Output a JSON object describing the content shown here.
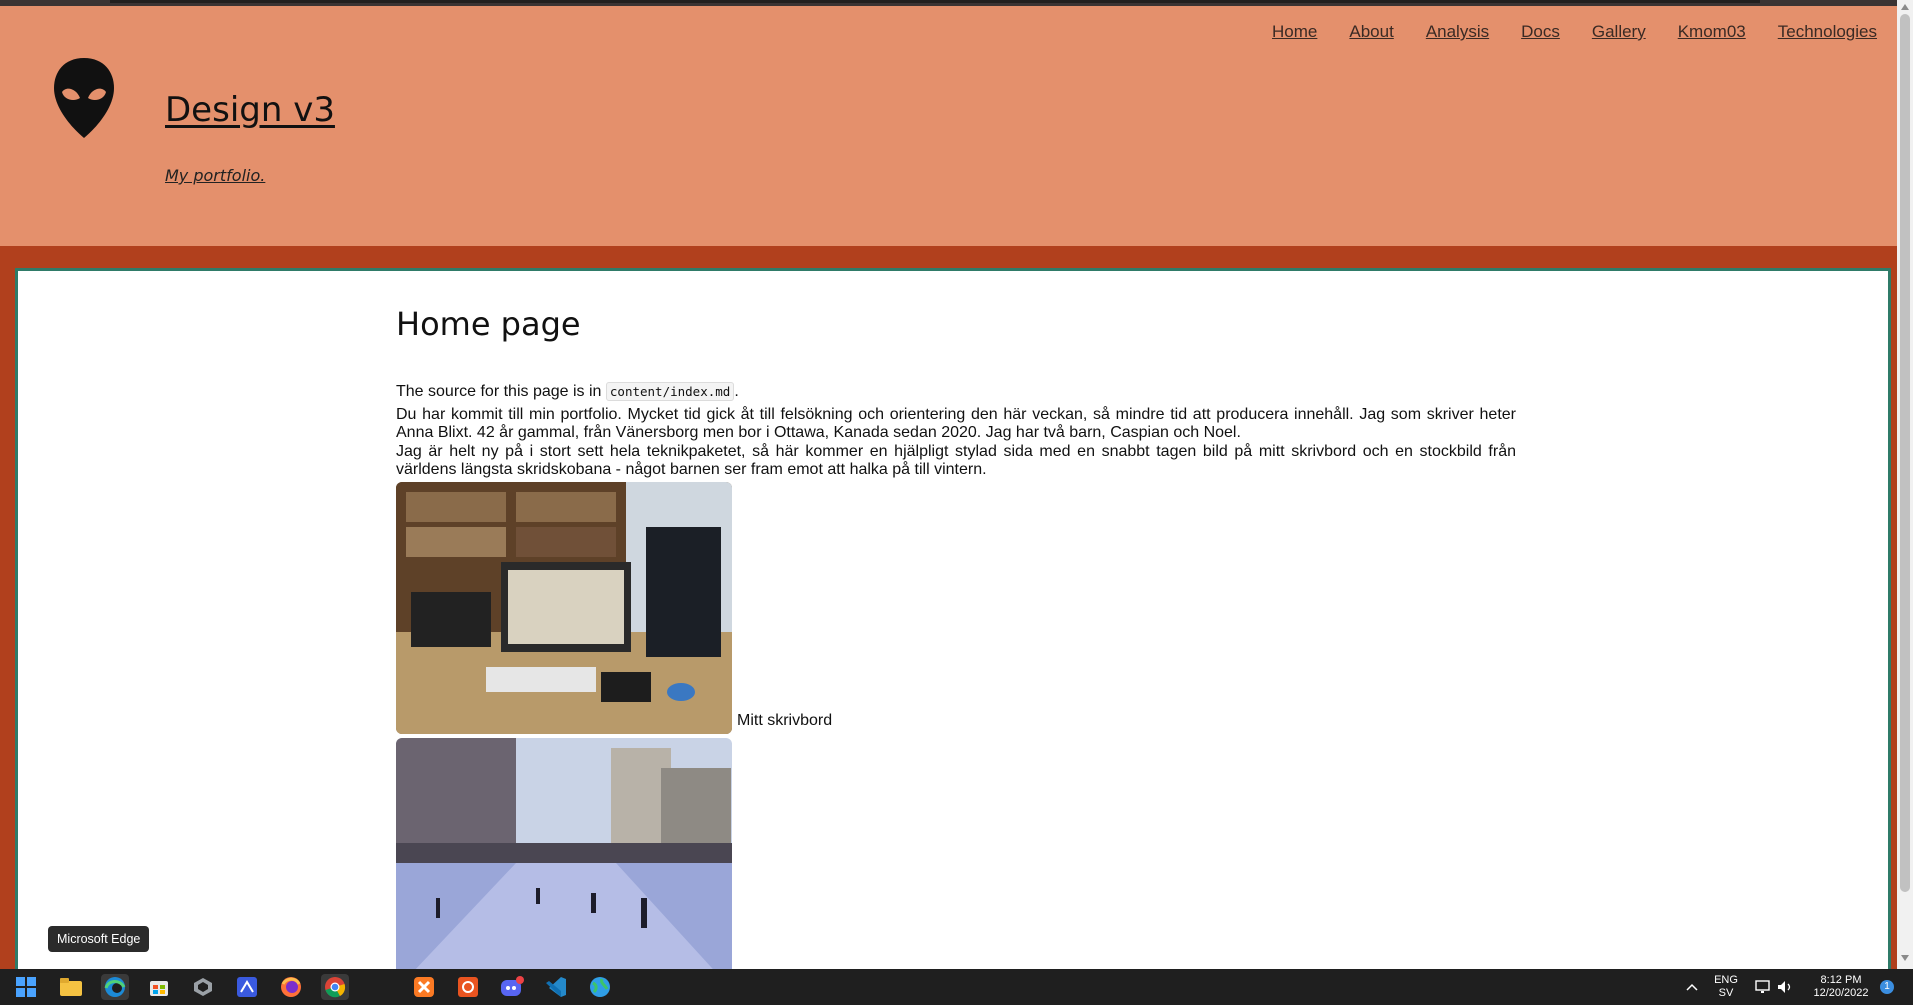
{
  "nav": [
    "Home",
    "About",
    "Analysis",
    "Docs",
    "Gallery",
    "Kmom03",
    "Technologies"
  ],
  "header": {
    "title": "Design v3",
    "slogan": "My portfolio."
  },
  "article": {
    "heading": "Home page",
    "source_prefix": "The source for this page is in ",
    "source_file": "content/index.md",
    "source_suffix": ".",
    "para1": "Du har kommit till min portfolio. Mycket tid gick åt till felsökning och orientering den här veckan, så mindre tid att producera innehåll. Jag som skriver heter Anna Blixt. 42 år gammal, från Vänersborg men bor i Ottawa, Kanada sedan 2020. Jag har två barn, Caspian och Noel.",
    "para2": "Jag är helt ny på i stort sett hela teknikpaketet, så här kommer en hjälpligt stylad sida med en snabbt tagen bild på mitt skrivbord och en stockbild från världens längsta skridskobana - något barnen ser fram emot att halka på till vintern.",
    "caption1": "Mitt skrivbord"
  },
  "tooltip": "Microsoft Edge",
  "tray": {
    "lang_top": "ENG",
    "lang_bottom": "SV",
    "time": "8:12 PM",
    "date": "12/20/2022",
    "notification_count": "1"
  },
  "taskbar_icons": [
    "start-icon",
    "file-explorer-icon",
    "edge-icon",
    "store-icon",
    "terminal-icon",
    "vs-icon",
    "firefox-icon",
    "chrome-icon",
    "xampp-icon",
    "ubuntu-icon",
    "discord-icon",
    "vscode-icon",
    "globe-icon"
  ],
  "colors": {
    "header_bg": "#e4906c",
    "frame_bg": "#b1401d",
    "content_border": "#2f7b68"
  }
}
